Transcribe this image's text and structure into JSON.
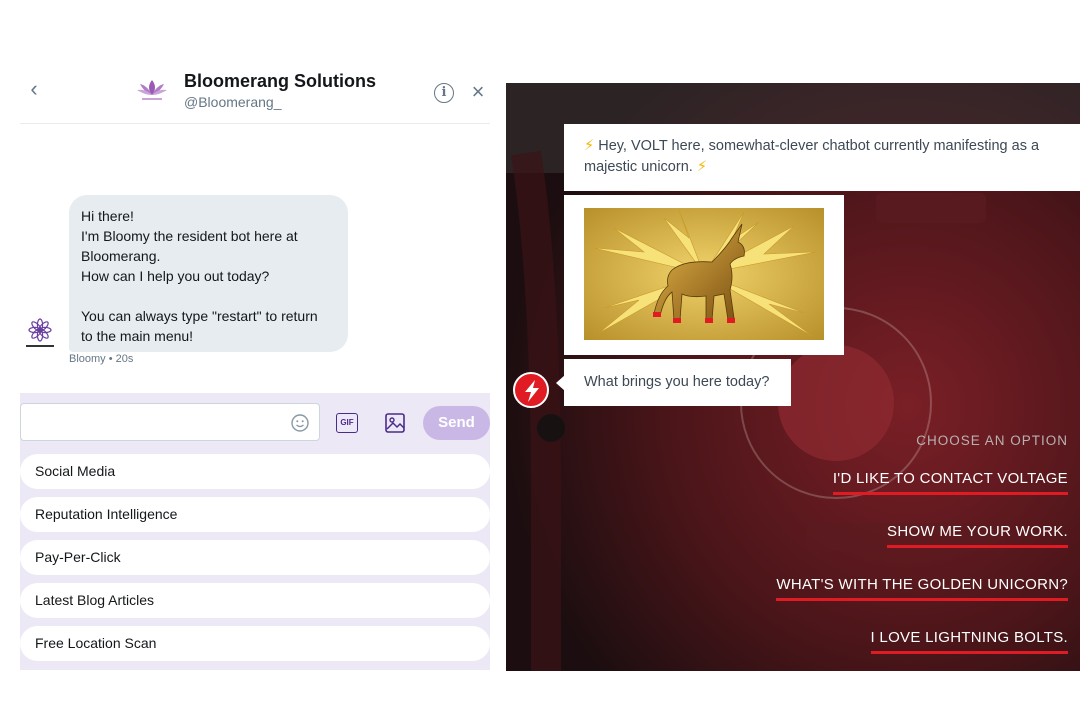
{
  "left_chat": {
    "header": {
      "back_icon": "chevron-left-icon",
      "name": "Bloomerang Solutions",
      "handle": "@Bloomerang_",
      "logo_text": "Bloomerang",
      "info_icon": "info-icon",
      "close_icon": "close-icon"
    },
    "message": {
      "lines": [
        "Hi there!",
        "I'm Bloomy the resident bot here at",
        "Bloomerang.",
        "How can I help you out today?",
        "You can always type \"restart\" to return",
        "to the main menu!"
      ],
      "meta": "Bloomy • 20s",
      "avatar_text": "Bloomerang"
    },
    "composer": {
      "input_value": "",
      "emoji_icon": "emoji-icon",
      "gif_label": "GIF",
      "image_icon": "image-icon",
      "send_label": "Send"
    },
    "quick_replies": [
      "Social Media",
      "Reputation Intelligence",
      "Pay-Per-Click",
      "Latest Blog Articles",
      "Free Location Scan"
    ]
  },
  "right_chat": {
    "greeting": "Hey, VOLT here, somewhat-clever chatbot currently manifesting as a majestic unicorn.",
    "greeting_emoji": "⚡",
    "image_subject": "golden-unicorn-image",
    "question": "What brings you here today?",
    "avatar_icon": "lightning-bolt-icon",
    "choose_label": "CHOOSE AN OPTION",
    "options": [
      "I'D LIKE TO CONTACT VOLTAGE",
      "SHOW ME YOUR WORK.",
      "WHAT'S WITH THE GOLDEN UNICORN?",
      "I LOVE LIGHTNING BOLTS."
    ],
    "colors": {
      "accent_red": "#e01b24",
      "bubble_text": "#3d4955"
    }
  },
  "colors": {
    "bloomerang_purple": "#c9b8e6",
    "compose_bg": "#ece8f5"
  }
}
